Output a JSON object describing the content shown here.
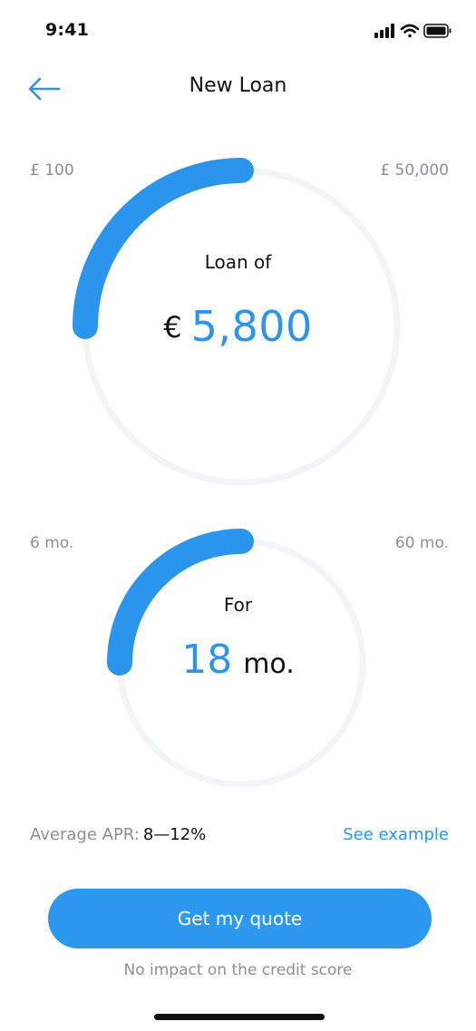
{
  "status_bar": {
    "time": "9:41"
  },
  "nav": {
    "title": "New Loan",
    "back_icon": "arrow-left-icon"
  },
  "loan_amount": {
    "min_label": "£ 100",
    "max_label": "£ 50,000",
    "caption": "Loan of",
    "currency": "€",
    "value": "5,800",
    "fill_fraction": 0.25
  },
  "loan_term": {
    "min_label": "6 mo.",
    "max_label": "60 mo.",
    "caption": "For",
    "value": "18",
    "unit": "mo.",
    "fill_fraction": 0.25
  },
  "apr": {
    "label": "Average APR:",
    "value": "8—12%",
    "link": "See example"
  },
  "cta": {
    "label": "Get my quote",
    "note": "No impact on the credit score"
  },
  "colors": {
    "accent": "#2b95ee",
    "track": "#f3f4f6",
    "muted": "#8a8f98"
  }
}
